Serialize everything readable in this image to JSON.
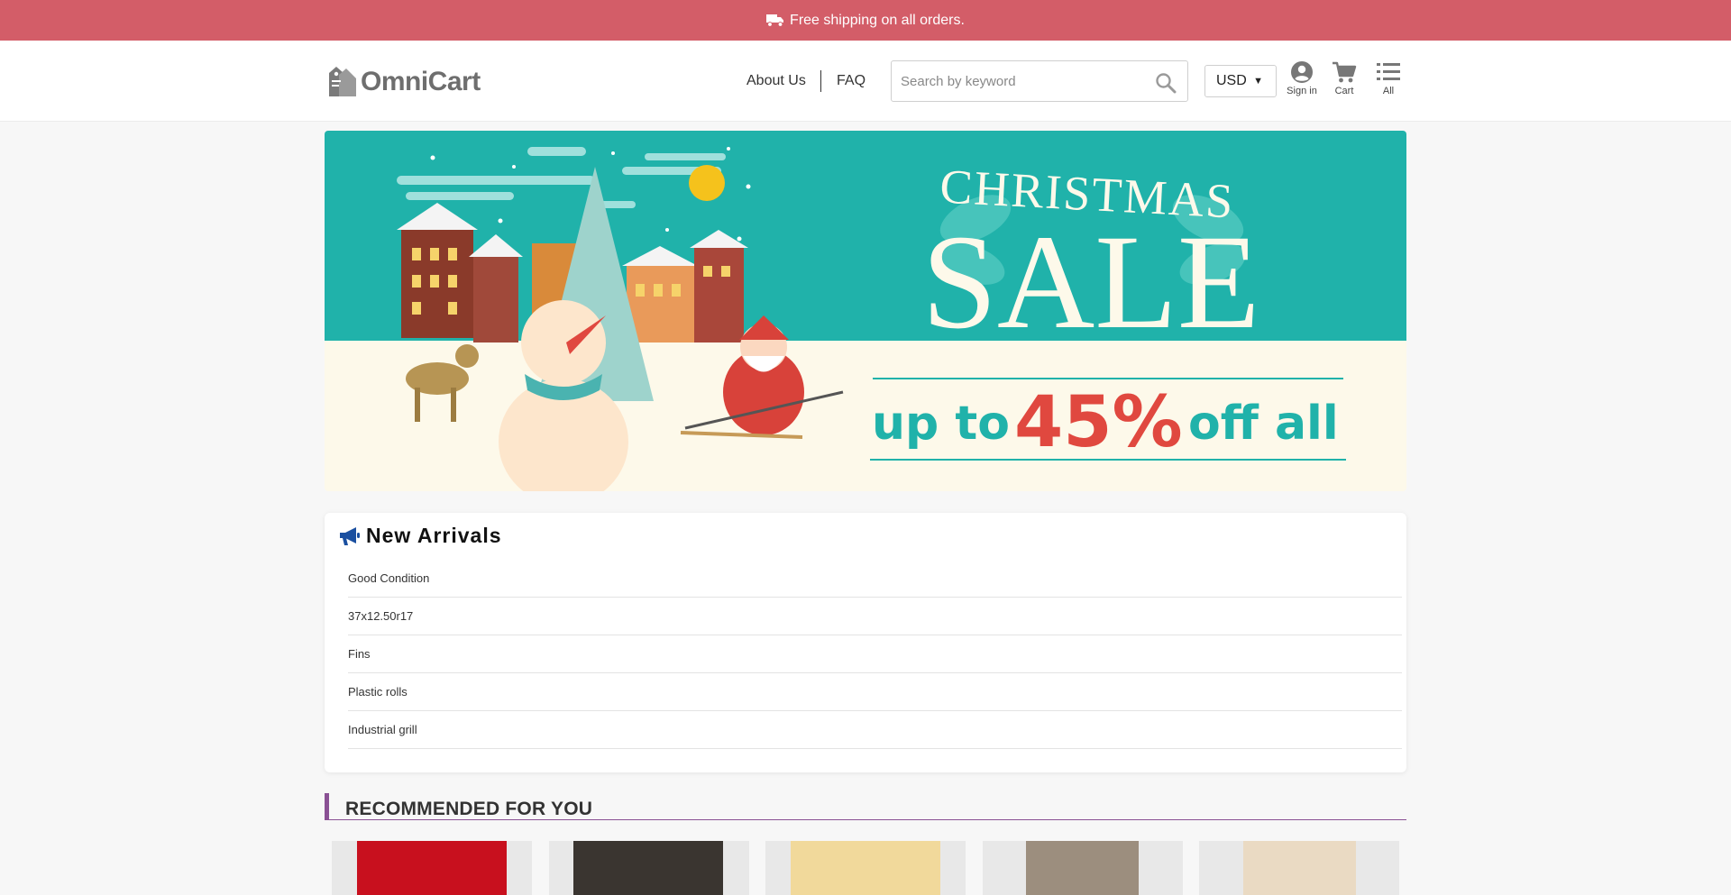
{
  "promo": {
    "text": "Free shipping on all orders."
  },
  "header": {
    "logo": "OmniCart",
    "nav": {
      "about": "About Us",
      "faq": "FAQ"
    },
    "search": {
      "placeholder": "Search by keyword",
      "value": ""
    },
    "currency": "USD",
    "icons": {
      "signin": "Sign in",
      "cart": "Cart",
      "all": "All"
    }
  },
  "banner": {
    "headline_top": "CHRISTMAS",
    "headline_main": "SALE",
    "offer_prefix": "up to",
    "offer_percent": "45%",
    "offer_suffix": "off all",
    "colors": {
      "teal": "#20b2aa",
      "cream": "#fdf9ea",
      "red": "#e0483f"
    }
  },
  "new_arrivals": {
    "title": "New Arrivals",
    "items": [
      "Good Condition",
      "37x12.50r17",
      "Fins",
      "Plastic rolls",
      "Industrial grill"
    ]
  },
  "recommended": {
    "title": "RECOMMENDED FOR YOU",
    "cards": [
      {
        "thumb_color": "#c8101e"
      },
      {
        "thumb_color": "#3a3530"
      },
      {
        "thumb_color": "#f1d99b"
      },
      {
        "thumb_color": "#9c8e7e"
      },
      {
        "thumb_color": "#eadac3"
      }
    ]
  },
  "colors": {
    "promo_bar": "#d35d68",
    "section_accent": "#8a5194",
    "icon_blue": "#1a4fa0"
  }
}
